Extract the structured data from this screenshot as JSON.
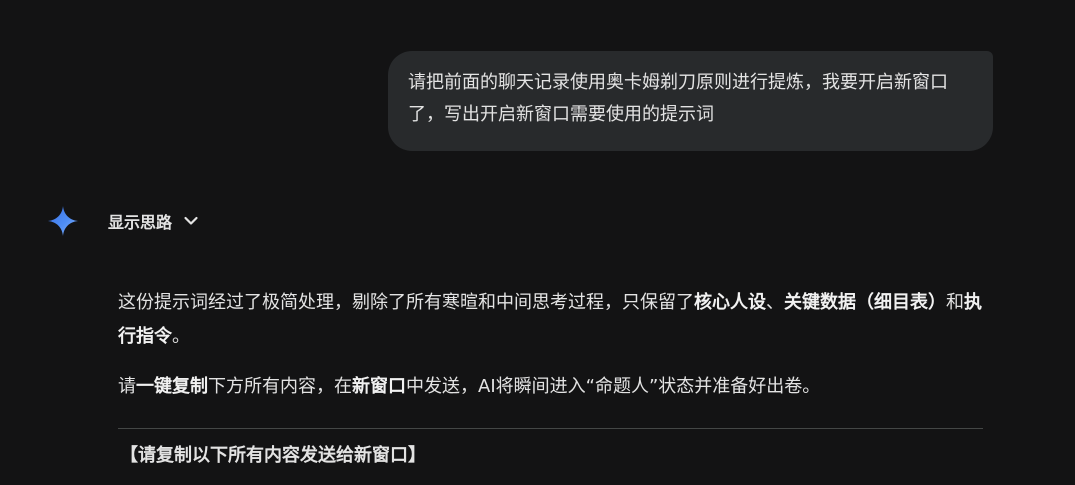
{
  "user_message": {
    "text": "请把前面的聊天记录使用奥卡姆剃刀原则进行提炼，我要开启新窗口了，写出开启新窗口需要使用的提示词"
  },
  "assistant": {
    "avatar_icon": "gemini-spark-icon",
    "thoughts_toggle": {
      "label": "显示思路",
      "icon": "chevron-down-icon"
    },
    "paragraph1": {
      "part1": "这份提示词经过了极简处理，剔除了所有寒暄和中间思考过程，只保留了",
      "bold1": "核心人设",
      "part2": "、",
      "bold2": "关键数据（细目表）",
      "part3": "和",
      "bold3": "执行指令",
      "part4": "。"
    },
    "paragraph2": {
      "part1": "请",
      "bold1": "一键复制",
      "part2": "下方所有内容，在",
      "bold2": "新窗口",
      "part3": "中发送，AI将瞬间进入“命题人”状态并准备好出卷。"
    },
    "copy_heading": "【请复制以下所有内容发送给新窗口】"
  },
  "colors": {
    "background": "#131314",
    "bubble": "#282a2c",
    "text": "#e3e3e3",
    "divider": "#444746",
    "spark_gradient_start": "#4e8df5",
    "spark_gradient_end": "#8ab4f8"
  }
}
